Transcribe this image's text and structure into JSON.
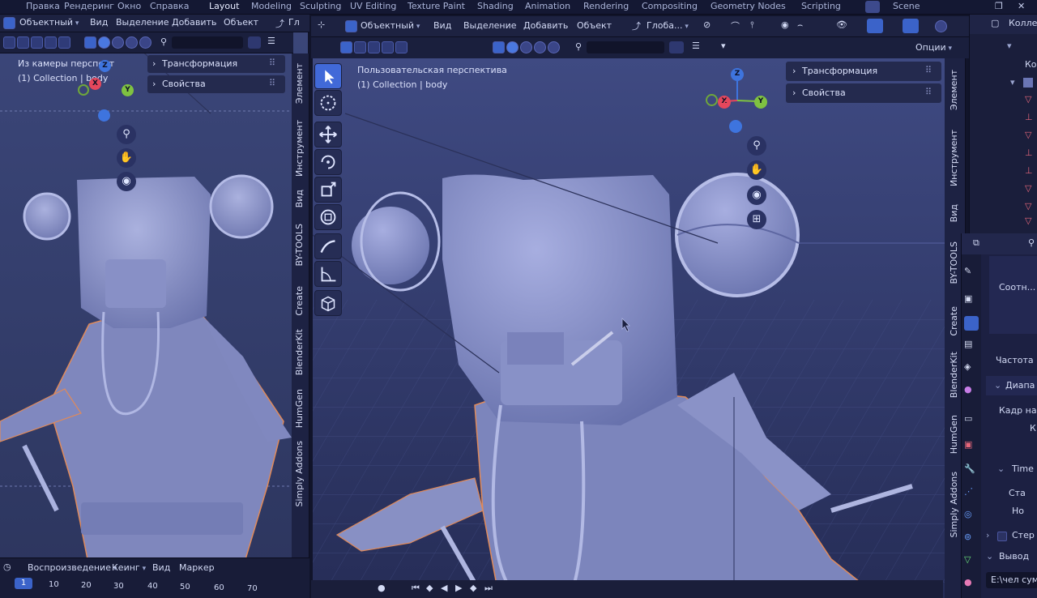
{
  "menubar": {
    "items": [
      "Правка",
      "Рендеринг",
      "Окно",
      "Справка"
    ],
    "workspaces": [
      "Layout",
      "Modeling",
      "Sculpting",
      "UV Editing",
      "Texture Paint",
      "Shading",
      "Animation",
      "Rendering",
      "Compositing",
      "Geometry Nodes",
      "Scripting"
    ],
    "active_workspace": "Layout",
    "scene": "Scene"
  },
  "left_viewport": {
    "mode": "Объектный",
    "menus": [
      "Вид",
      "Выделение",
      "Добавить",
      "Объект"
    ],
    "orientation": "Гл",
    "view_name": "Из камеры перспект",
    "collection": "(1) Collection | body",
    "panels": [
      "Трансформация",
      "Свойства"
    ],
    "tabs": [
      "Элемент",
      "Инструмент",
      "Вид",
      "BY-TOOLS",
      "Create",
      "BlenderKit",
      "HumGen",
      "Simply Addons"
    ]
  },
  "main_viewport": {
    "mode": "Объектный",
    "menus": [
      "Вид",
      "Выделение",
      "Добавить",
      "Объект"
    ],
    "orientation": "Глоба...",
    "options": "Опции",
    "view_name": "Пользовательская перспектива",
    "collection": "(1) Collection | body",
    "panels": [
      "Трансформация",
      "Свойства"
    ],
    "tabs": [
      "Элемент",
      "Инструмент",
      "Вид",
      "BY-TOOLS",
      "Create",
      "BlenderKit",
      "HumGen",
      "Simply Addons"
    ],
    "gizmo": {
      "x": "X",
      "y": "Y",
      "z": "Z"
    }
  },
  "timeline": {
    "menus": [
      "Воспроизведение",
      "Кеинг",
      "Вид",
      "Маркер"
    ],
    "frames": [
      "1",
      "10",
      "20",
      "30",
      "40",
      "50",
      "60",
      "70"
    ],
    "current_frame": "1"
  },
  "outliner": {
    "header": "Колле",
    "item": "Ко"
  },
  "properties": {
    "field_short": "Соотн...",
    "frame_rate": "Частота",
    "frame_range_section": "Диапа",
    "frame_start": "Кадр на",
    "frame_k": "К",
    "time_section": "Time",
    "time_sta": "Ста",
    "time_no": "Но",
    "stereo": "Стер",
    "output_section": "Вывод",
    "output_path": "E:\\чел сум"
  },
  "colors": {
    "accent": "#4169d8",
    "x_axis": "#e4475c",
    "y_axis": "#7fc241",
    "z_axis": "#3e74de",
    "model": "#8e96cc",
    "viewport_bg": "#3a4578"
  }
}
